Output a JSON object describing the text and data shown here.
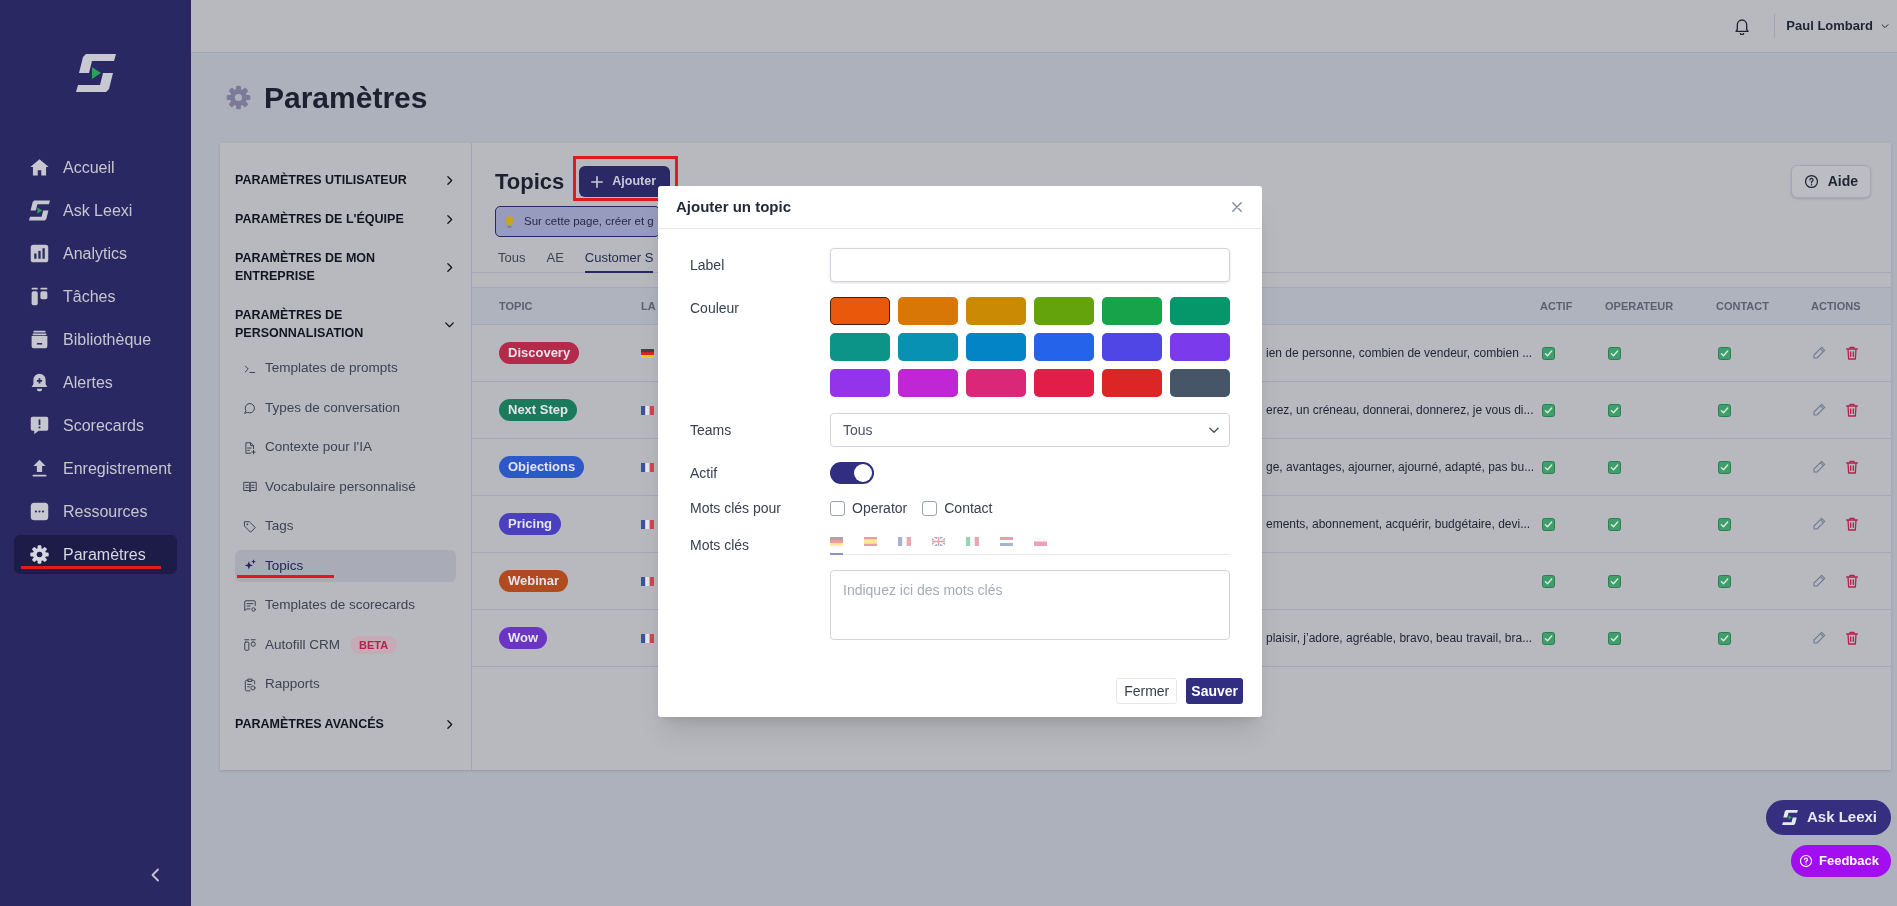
{
  "sidebar": {
    "items": [
      {
        "label": "Accueil",
        "selected": false
      },
      {
        "label": "Ask Leexi",
        "selected": false
      },
      {
        "label": "Analytics",
        "selected": false
      },
      {
        "label": "Tâches",
        "selected": false
      },
      {
        "label": "Bibliothèque",
        "selected": false
      },
      {
        "label": "Alertes",
        "selected": false
      },
      {
        "label": "Scorecards",
        "selected": false
      },
      {
        "label": "Enregistrement",
        "selected": false
      },
      {
        "label": "Ressources",
        "selected": false
      },
      {
        "label": "Paramètres",
        "selected": true,
        "marked": true
      }
    ]
  },
  "header": {
    "user_name": "Paul Lombard"
  },
  "page": {
    "title": "Paramètres"
  },
  "settings_menu": {
    "sections": [
      {
        "label": "PARAMÈTRES UTILISATEUR",
        "expanded": false
      },
      {
        "label": "PARAMÈTRES DE L'ÉQUIPE",
        "expanded": false
      },
      {
        "label": "PARAMÈTRES DE MON ENTREPRISE",
        "expanded": false
      },
      {
        "label": "PARAMÈTRES DE PERSONNALISATION",
        "expanded": true,
        "children": [
          {
            "label": "Templates de prompts",
            "selected": false
          },
          {
            "label": "Types de conversation",
            "selected": false
          },
          {
            "label": "Contexte pour l'IA",
            "selected": false
          },
          {
            "label": "Vocabulaire personnalisé",
            "selected": false
          },
          {
            "label": "Tags",
            "selected": false
          },
          {
            "label": "Topics",
            "selected": true,
            "marked": true
          },
          {
            "label": "Templates de scorecards",
            "selected": false
          },
          {
            "label": "Autofill CRM",
            "selected": false,
            "badge": "BETA"
          },
          {
            "label": "Rapports",
            "selected": false
          }
        ]
      },
      {
        "label": "PARAMÈTRES AVANCÉS",
        "expanded": false
      }
    ]
  },
  "topics": {
    "title": "Topics",
    "add_button": {
      "label": "Ajouter",
      "marked": true
    },
    "help_button": "Aide",
    "banner": "Sur cette page, créer et g",
    "tabs": [
      {
        "label": "Tous",
        "selected": false
      },
      {
        "label": "AE",
        "selected": false
      },
      {
        "label": "Customer S",
        "selected": true
      }
    ],
    "table": {
      "columns": [
        "TOPIC",
        "LA",
        "ACTIF",
        "OPERATEUR",
        "CONTACT",
        "ACTIONS"
      ],
      "rows": [
        {
          "topic": "Discovery",
          "color": "#b32a4b",
          "kind": "de",
          "keywords": "ien de personne, combien de vendeur, combien ...",
          "actif": true,
          "operator": true,
          "contact": true
        },
        {
          "topic": "Next Step",
          "color": "#1a7a5c",
          "kind": "fr",
          "keywords": "erez, un créneau, donnerai, donnerez, je vous di...",
          "actif": true,
          "operator": true,
          "contact": true
        },
        {
          "topic": "Objections",
          "color": "#2d58c8",
          "kind": "fr",
          "keywords": "ge, avantages, ajourner, ajourné, adapté, pas bu...",
          "actif": true,
          "operator": true,
          "contact": true
        },
        {
          "topic": "Pricing",
          "color": "#4a3fbe",
          "kind": "fr",
          "keywords": "ements, abonnement, acquérir, budgétaire, devi...",
          "actif": true,
          "operator": true,
          "contact": true
        },
        {
          "topic": "Webinar",
          "color": "#b04a1f",
          "kind": "fr",
          "actif": true,
          "operator": true,
          "contact": true
        },
        {
          "topic": "Wow",
          "color": "#6a35c4",
          "kind": "fr",
          "keywords": "plaisir, j’adore, agréable, bravo, beau travail, bra...",
          "actif": true,
          "operator": true,
          "contact": true
        }
      ]
    }
  },
  "modal": {
    "title": "Ajouter un topic",
    "fields": [
      {
        "kind": "text",
        "label": "Label"
      },
      {
        "kind": "colors",
        "label": "Couleur",
        "swatches": [
          {
            "color": "#ea580c",
            "selected": true
          },
          {
            "color": "#d97706",
            "selected": false
          },
          {
            "color": "#ca8a04",
            "selected": false
          },
          {
            "color": "#65a30d",
            "selected": false
          },
          {
            "color": "#16a34a",
            "selected": false
          },
          {
            "color": "#059669",
            "selected": false
          },
          {
            "color": "#0d9488",
            "selected": false
          },
          {
            "color": "#0891b2",
            "selected": false
          },
          {
            "color": "#0284c7",
            "selected": false
          },
          {
            "color": "#2563eb",
            "selected": false
          },
          {
            "color": "#4f46e5",
            "selected": false
          },
          {
            "color": "#7c3aed",
            "selected": false
          },
          {
            "color": "#9333ea",
            "selected": false
          },
          {
            "color": "#c026d3",
            "selected": false
          },
          {
            "color": "#db2777",
            "selected": false
          },
          {
            "color": "#e11d48",
            "selected": false
          },
          {
            "color": "#dc2626",
            "selected": false
          },
          {
            "color": "#475569",
            "selected": false
          }
        ]
      },
      {
        "kind": "select",
        "label": "Teams",
        "value": "Tous"
      },
      {
        "kind": "toggle",
        "label": "Actif",
        "on": true
      },
      {
        "kind": "checkboxes",
        "label": "Mots clés pour",
        "options": [
          {
            "label": "Operator",
            "checked": false
          },
          {
            "label": "Contact",
            "checked": false
          }
        ]
      },
      {
        "kind": "keywords",
        "label": "Mots clés",
        "languages": [
          {
            "kind": "de",
            "selected": true
          },
          {
            "kind": "es",
            "selected": false
          },
          {
            "kind": "fr",
            "selected": false
          },
          {
            "kind": "gb",
            "selected": false
          },
          {
            "kind": "it",
            "selected": false
          },
          {
            "kind": "nl",
            "selected": false
          },
          {
            "kind": "pl",
            "selected": false
          }
        ],
        "placeholder": "Indiquez ici des mots clés"
      }
    ],
    "buttons": [
      {
        "label": "Fermer",
        "kind": "secondary"
      },
      {
        "label": "Sauver",
        "kind": "primary"
      }
    ]
  },
  "floating_buttons": [
    {
      "label": "Ask Leexi",
      "kind": "assistant"
    },
    {
      "label": "Feedback",
      "kind": "feedback"
    }
  ]
}
